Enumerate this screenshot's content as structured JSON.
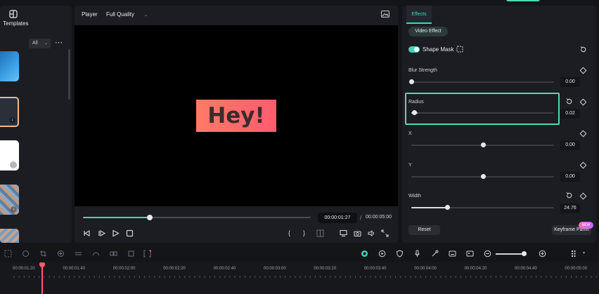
{
  "left_panel": {
    "tab_label": "Templates",
    "filter_value": "All"
  },
  "player": {
    "label": "Player",
    "quality": "Full Quality",
    "preview_text": "Hey!",
    "time_current": "00:00:01:27",
    "time_separator": "/",
    "time_total": "00:00:05:00",
    "progress": 0.3,
    "bracket_in": "{",
    "bracket_out": "}"
  },
  "effects": {
    "tab": "Effects",
    "category": "Video Effect",
    "effect_name": "Shape Mask",
    "params": [
      {
        "label": "Blur Strength",
        "value": "0.00",
        "level": 0.0
      },
      {
        "label": "Radius",
        "value": "0.02",
        "level": 0.02
      },
      {
        "label": "X",
        "value": "0.00",
        "level": 0.5
      },
      {
        "label": "Y",
        "value": "0.00",
        "level": 0.5
      },
      {
        "label": "Width",
        "value": "24.76",
        "level": 0.25
      }
    ],
    "reset_label": "Reset",
    "keyframe_label": "Keyframe Panel",
    "new_badge": "NEW"
  },
  "timeline": {
    "ruler_labels": [
      "00:00:01:20",
      "00:00:01:40",
      "00:00:02:00",
      "00:00:02:20",
      "00:00:02:40",
      "00:00:03:00",
      "00:00:03:20",
      "00:00:03:40",
      "00:00:04:00",
      "00:00:04:20",
      "00:00:04:40",
      "00:00:05:00"
    ]
  },
  "colors": {
    "accent": "#3fd6b4",
    "playhead": "#ff5b6e",
    "hey_gradient_start": "#ff7a66",
    "hey_gradient_end": "#ff5b6e"
  },
  "icons": [
    "templates-icon",
    "more-icon",
    "download-icon",
    "snapshot-icon",
    "prev-frame-icon",
    "play-icon",
    "next-icon",
    "stop-icon",
    "split-icon",
    "monitor-icon",
    "camera-icon",
    "volume-icon",
    "fullscreen-icon",
    "mask-shape-icon",
    "reset-icon",
    "keyframe-icon"
  ]
}
